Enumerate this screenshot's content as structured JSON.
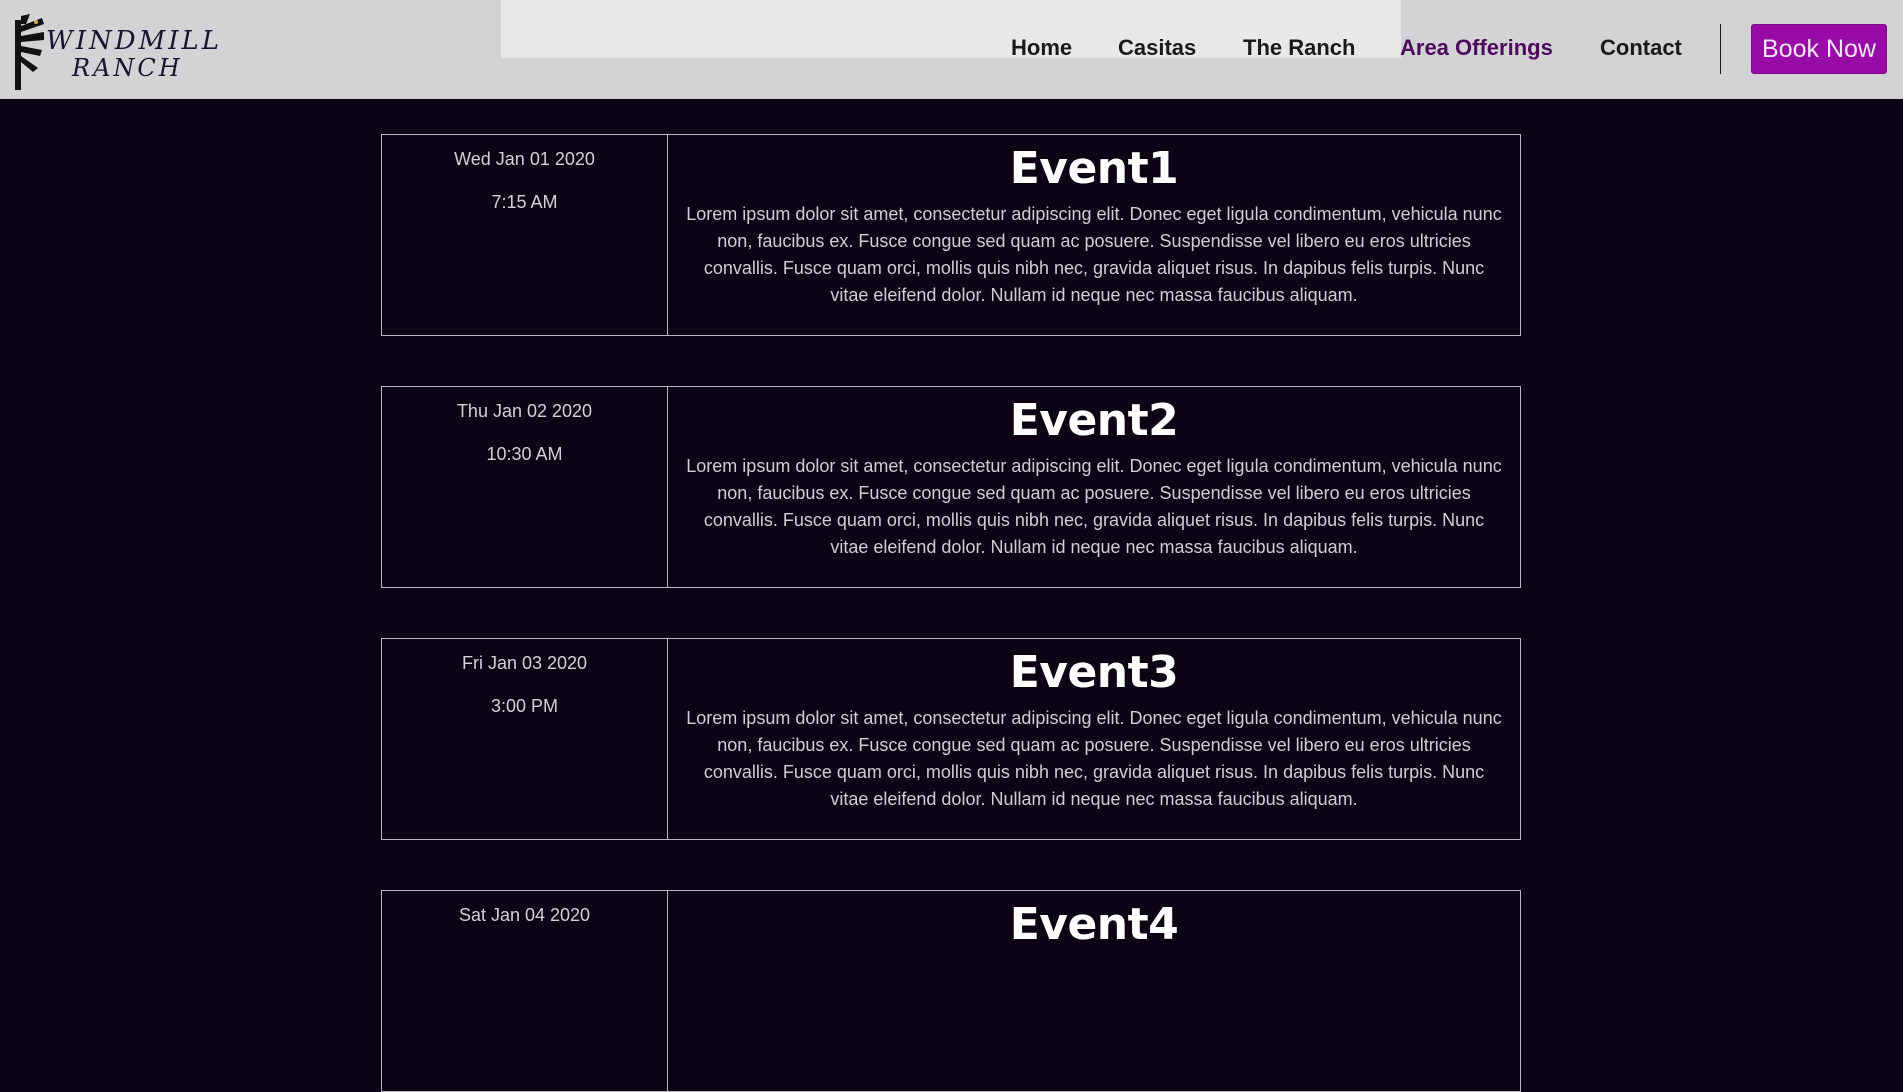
{
  "brand": {
    "line1": "WINDMILL",
    "line2": "RANCH"
  },
  "nav": {
    "items": [
      {
        "label": "Home"
      },
      {
        "label": "Casitas"
      },
      {
        "label": "The Ranch"
      },
      {
        "label": "Area Offerings"
      },
      {
        "label": "Contact"
      }
    ],
    "book_label": "Book Now"
  },
  "colors": {
    "accent": "#980ba6",
    "active_nav": "#4d0a5c",
    "background": "#0c0415",
    "header": "#d3d3d5"
  },
  "events": [
    {
      "day": "Wed Jan 01 2020",
      "time": "7:15 AM",
      "title": "Event1",
      "description": "Lorem ipsum dolor sit amet, consectetur adipiscing elit. Donec eget ligula condimentum, vehicula nunc non, faucibus ex. Fusce congue sed quam ac posuere. Suspendisse vel libero eu eros ultricies convallis. Fusce quam orci, mollis quis nibh nec, gravida aliquet risus. In dapibus felis turpis. Nunc vitae eleifend dolor. Nullam id neque nec massa faucibus aliquam."
    },
    {
      "day": "Thu Jan 02 2020",
      "time": "10:30 AM",
      "title": "Event2",
      "description": "Lorem ipsum dolor sit amet, consectetur adipiscing elit. Donec eget ligula condimentum, vehicula nunc non, faucibus ex. Fusce congue sed quam ac posuere. Suspendisse vel libero eu eros ultricies convallis. Fusce quam orci, mollis quis nibh nec, gravida aliquet risus. In dapibus felis turpis. Nunc vitae eleifend dolor. Nullam id neque nec massa faucibus aliquam."
    },
    {
      "day": "Fri Jan 03 2020",
      "time": "3:00 PM",
      "title": "Event3",
      "description": "Lorem ipsum dolor sit amet, consectetur adipiscing elit. Donec eget ligula condimentum, vehicula nunc non, faucibus ex. Fusce congue sed quam ac posuere. Suspendisse vel libero eu eros ultricies convallis. Fusce quam orci, mollis quis nibh nec, gravida aliquet risus. In dapibus felis turpis. Nunc vitae eleifend dolor. Nullam id neque nec massa faucibus aliquam."
    },
    {
      "day": "Sat Jan 04 2020",
      "time": "",
      "title": "Event4",
      "description": ""
    }
  ]
}
